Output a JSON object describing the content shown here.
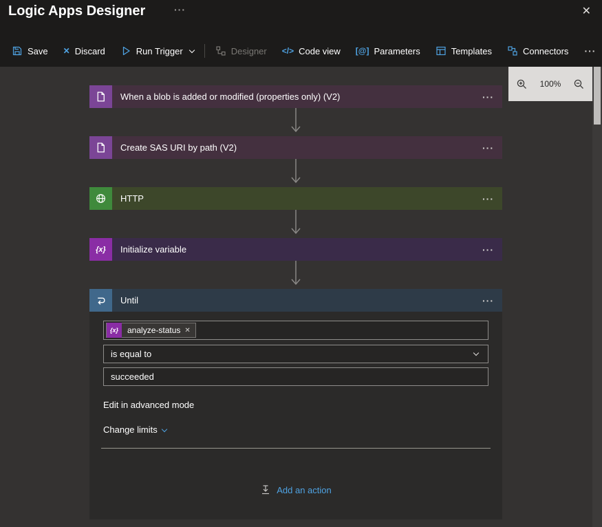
{
  "titlebar": {
    "title": "Logic Apps Designer",
    "more_glyph": "···",
    "close_glyph": "✕"
  },
  "toolbar": {
    "save": "Save",
    "discard": "Discard",
    "run_trigger": "Run Trigger",
    "designer": "Designer",
    "code_view": "Code view",
    "parameters": "Parameters",
    "templates": "Templates",
    "connectors": "Connectors",
    "more_glyph": "···",
    "glyphs": {
      "discard": "✕",
      "code_view": "</>",
      "parameters": "[@]"
    }
  },
  "zoom": {
    "level": "100%"
  },
  "workflow": {
    "cards": [
      {
        "title": "When a blob is added or modified (properties only) (V2)",
        "menu_glyph": "···",
        "icon": "blob-trigger-icon"
      },
      {
        "title": "Create SAS URI by path (V2)",
        "menu_glyph": "···",
        "icon": "blob-action-icon"
      },
      {
        "title": "HTTP",
        "menu_glyph": "···",
        "icon": "http-globe-icon"
      },
      {
        "title": "Initialize variable",
        "menu_glyph": "···",
        "icon": "variable-icon"
      },
      {
        "title": "Until",
        "menu_glyph": "···",
        "icon": "until-loop-icon"
      }
    ],
    "until_panel": {
      "token": {
        "icon_glyph": "{x}",
        "label": "analyze-status",
        "remove_glyph": "✕"
      },
      "operator": "is equal to",
      "value": "succeeded",
      "edit_advanced": "Edit in advanced mode",
      "change_limits": "Change limits",
      "add_action": "Add an action"
    },
    "variable_glyph": "{x}"
  },
  "colors": {
    "accent_blue": "#4fa3e3",
    "topbar_bg": "#1c1b1a",
    "canvas_bg": "#343231",
    "until_body_bg": "#2b2a29",
    "blob_tile": "#7b4596",
    "blob_header": "#44303f",
    "http_tile": "#3f8a3c",
    "http_header": "#3d472a",
    "variable_tile": "#8a2da5",
    "variable_header": "#3a2b49",
    "until_tile": "#40688b",
    "until_header": "#2e3b48"
  }
}
